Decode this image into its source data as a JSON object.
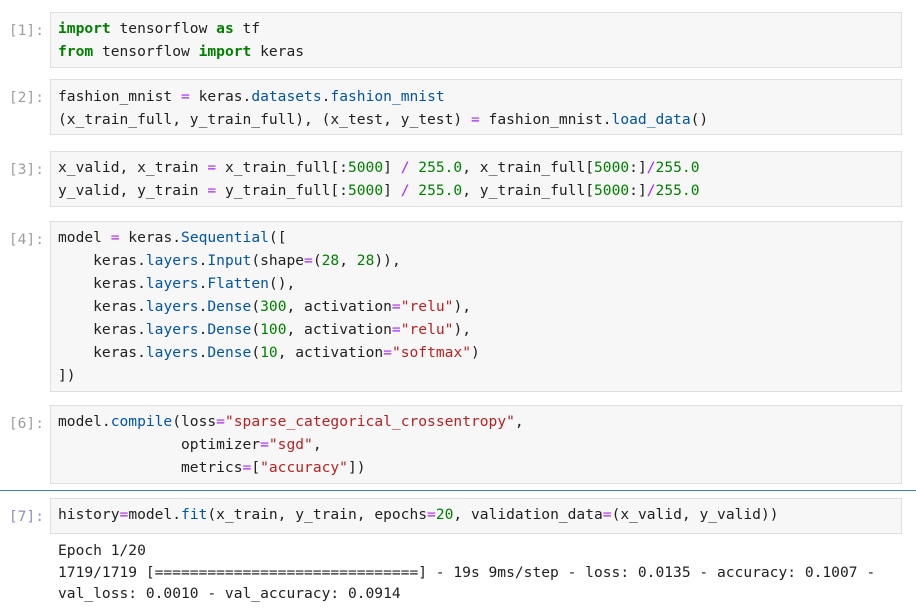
{
  "cells": [
    {
      "prompt": "[1]:",
      "lines": [
        [
          [
            "kw",
            "import"
          ],
          [
            "",
            " tensorflow "
          ],
          [
            "kw",
            "as"
          ],
          [
            "",
            " tf"
          ]
        ],
        [
          [
            "kw",
            "from"
          ],
          [
            "",
            " tensorflow "
          ],
          [
            "kw",
            "import"
          ],
          [
            "",
            " keras"
          ]
        ]
      ]
    },
    {
      "prompt": "[2]:",
      "lines": [
        [
          [
            "",
            "fashion_mnist "
          ],
          [
            "op",
            "="
          ],
          [
            "",
            " keras."
          ],
          [
            "at",
            "datasets"
          ],
          [
            "",
            "."
          ],
          [
            "at",
            "fashion_mnist"
          ]
        ],
        [
          [
            "",
            "(x_train_full, y_train_full), (x_test, y_test) "
          ],
          [
            "op",
            "="
          ],
          [
            "",
            " fashion_mnist."
          ],
          [
            "at",
            "load_data"
          ],
          [
            "",
            "()"
          ]
        ]
      ]
    },
    {
      "prompt": "[3]:",
      "lines": [
        [
          [
            "",
            "x_valid, x_train "
          ],
          [
            "op",
            "="
          ],
          [
            "",
            " x_train_full[:"
          ],
          [
            "nu",
            "5000"
          ],
          [
            "",
            "] "
          ],
          [
            "op",
            "/"
          ],
          [
            "",
            ""
          ],
          [
            "nu",
            " 255.0"
          ],
          [
            "",
            ", x_train_full["
          ],
          [
            "nu",
            "5000"
          ],
          [
            "",
            ":]"
          ],
          [
            "op",
            "/"
          ],
          [
            "nu",
            "255.0"
          ]
        ],
        [
          [
            "",
            "y_valid, y_train "
          ],
          [
            "op",
            "="
          ],
          [
            "",
            " y_train_full[:"
          ],
          [
            "nu",
            "5000"
          ],
          [
            "",
            "] "
          ],
          [
            "op",
            "/"
          ],
          [
            "nu",
            " 255.0"
          ],
          [
            "",
            ", y_train_full["
          ],
          [
            "nu",
            "5000"
          ],
          [
            "",
            ":]"
          ],
          [
            "op",
            "/"
          ],
          [
            "nu",
            "255.0"
          ]
        ]
      ]
    },
    {
      "prompt": "[4]:",
      "lines": [
        [
          [
            "",
            "model "
          ],
          [
            "op",
            "="
          ],
          [
            "",
            " keras."
          ],
          [
            "at",
            "Sequential"
          ],
          [
            "",
            "(["
          ]
        ],
        [
          [
            "",
            "    keras."
          ],
          [
            "at",
            "layers"
          ],
          [
            "",
            "."
          ],
          [
            "at",
            "Input"
          ],
          [
            "",
            "(shape"
          ],
          [
            "op",
            "="
          ],
          [
            "",
            "("
          ],
          [
            "nu",
            "28"
          ],
          [
            "",
            ", "
          ],
          [
            "nu",
            "28"
          ],
          [
            "",
            ")),"
          ]
        ],
        [
          [
            "",
            "    keras."
          ],
          [
            "at",
            "layers"
          ],
          [
            "",
            "."
          ],
          [
            "at",
            "Flatten"
          ],
          [
            "",
            "(),"
          ]
        ],
        [
          [
            "",
            "    keras."
          ],
          [
            "at",
            "layers"
          ],
          [
            "",
            "."
          ],
          [
            "at",
            "Dense"
          ],
          [
            "",
            "("
          ],
          [
            "nu",
            "300"
          ],
          [
            "",
            ", activation"
          ],
          [
            "op",
            "="
          ],
          [
            "st",
            "\"relu\""
          ],
          [
            "",
            "),"
          ]
        ],
        [
          [
            "",
            "    keras."
          ],
          [
            "at",
            "layers"
          ],
          [
            "",
            "."
          ],
          [
            "at",
            "Dense"
          ],
          [
            "",
            "("
          ],
          [
            "nu",
            "100"
          ],
          [
            "",
            ", activation"
          ],
          [
            "op",
            "="
          ],
          [
            "st",
            "\"relu\""
          ],
          [
            "",
            "),"
          ]
        ],
        [
          [
            "",
            "    keras."
          ],
          [
            "at",
            "layers"
          ],
          [
            "",
            "."
          ],
          [
            "at",
            "Dense"
          ],
          [
            "",
            "("
          ],
          [
            "nu",
            "10"
          ],
          [
            "",
            ", activation"
          ],
          [
            "op",
            "="
          ],
          [
            "st",
            "\"softmax\""
          ],
          [
            "",
            ")"
          ]
        ],
        [
          [
            "",
            "])"
          ]
        ]
      ]
    },
    {
      "prompt": "[6]:",
      "lines": [
        [
          [
            "",
            "model."
          ],
          [
            "at",
            "compile"
          ],
          [
            "",
            "(loss"
          ],
          [
            "op",
            "="
          ],
          [
            "st",
            "\"sparse_categorical_crossentropy\""
          ],
          [
            "",
            ","
          ]
        ],
        [
          [
            "",
            "              optimizer"
          ],
          [
            "op",
            "="
          ],
          [
            "st",
            "\"sgd\""
          ],
          [
            "",
            ","
          ]
        ],
        [
          [
            "",
            "              metrics"
          ],
          [
            "op",
            "="
          ],
          [
            "",
            "["
          ],
          [
            "st",
            "\"accuracy\""
          ],
          [
            "",
            "])"
          ]
        ]
      ]
    },
    {
      "prompt": "[7]:",
      "lines": [
        [
          [
            "",
            "history"
          ],
          [
            "op",
            "="
          ],
          [
            "",
            "model."
          ],
          [
            "at",
            "fit"
          ],
          [
            "",
            "(x_train, y_train, epochs"
          ],
          [
            "op",
            "="
          ],
          [
            "nu",
            "20"
          ],
          [
            "",
            ", validation_data"
          ],
          [
            "op",
            "="
          ],
          [
            "",
            "(x_valid, y_valid))"
          ]
        ]
      ]
    }
  ],
  "output": [
    "Epoch 1/20",
    "1719/1719 [==============================] - 19s 9ms/step - loss: 0.0135 - accuracy: 0.1007 -",
    "val_loss: 0.0010 - val_accuracy: 0.0914"
  ]
}
